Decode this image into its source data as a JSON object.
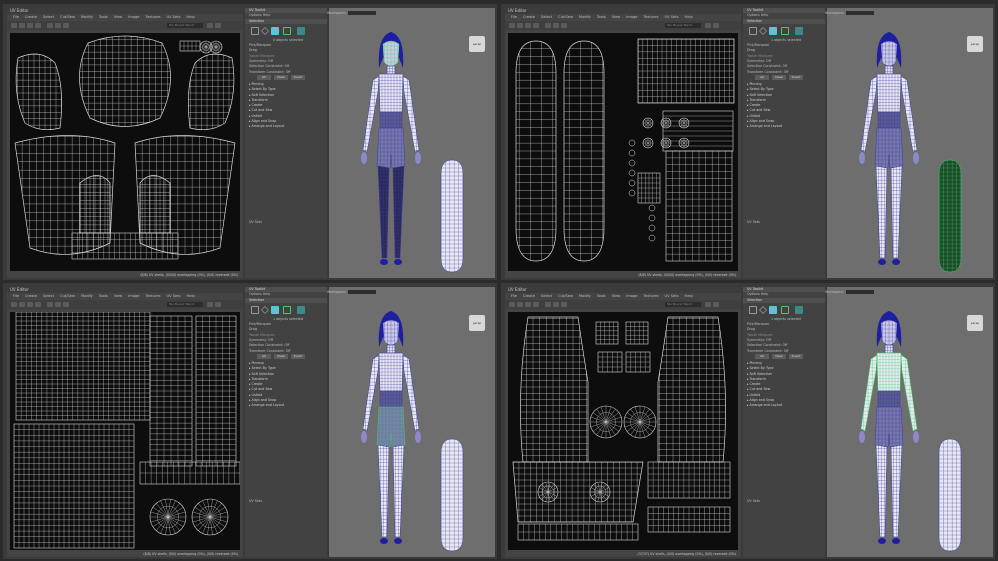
{
  "panels": [
    {
      "uv_title": "UV Editor",
      "menu": [
        "File",
        "Create",
        "Select",
        "Cut/Sew",
        "Modify",
        "Tools",
        "View",
        "Image",
        "Textures",
        "UV Sets",
        "Help"
      ],
      "search_placeholder": "Tex Bound Texcd",
      "status": "(8/8) UV shells, (0/0/0) overlapping (0%), (0/0) reversed (0%)",
      "uv_sets": "UV Sets",
      "toolkit_title": "UV Toolkit",
      "toolkit_menu": "Options  Help",
      "workspace_label": "Workspace:",
      "selection_header": "Selection",
      "pick_marquee": "Pick/Marquee",
      "drag": "Drag",
      "tweak": "Tweak Marquee",
      "selected_text": "0 objects selected",
      "symmetry": "Symmetry:  Off",
      "selection_constraint": "Selection Constraint:  Off",
      "transform_constraint": "Transform Constraint:  Off",
      "btn_all": "All",
      "btn_clear": "Clear",
      "btn_invert": "Invert",
      "sections": [
        "Pinning",
        "Select By Type",
        "Soft Selection",
        "Transform",
        "Create",
        "Cut and Sew",
        "Unfold",
        "Align and Snap",
        "Arrange and Layout"
      ],
      "persp": "persp",
      "highlight": "head"
    },
    {
      "uv_title": "UV Editor",
      "menu": [
        "File",
        "Create",
        "Select",
        "Cut/Sew",
        "Modify",
        "Tools",
        "View",
        "Image",
        "Textures",
        "UV Sets",
        "Help"
      ],
      "search_placeholder": "Tex Bound Texcd",
      "status": "(8/8) UV shells, (0/0/0) overlapping (0%), (0/0) reversed (0%)",
      "uv_sets": "UV Sets",
      "toolkit_title": "UV Toolkit",
      "toolkit_menu": "Options  Help",
      "workspace_label": "Workspace:",
      "selection_header": "Selection",
      "pick_marquee": "Pick/Marquee",
      "drag": "Drag",
      "tweak": "Tweak Marquee",
      "selected_text": "1 objects selected",
      "symmetry": "Symmetry:  Off",
      "selection_constraint": "Selection Constraint:  Off",
      "transform_constraint": "Transform Constraint:  Off",
      "btn_all": "All",
      "btn_clear": "Clear",
      "btn_invert": "Invert",
      "sections": [
        "Pinning",
        "Select By Type",
        "Soft Selection",
        "Transform",
        "Create",
        "Cut and Sew",
        "Unfold",
        "Align and Snap",
        "Arrange and Layout"
      ],
      "persp": "persp",
      "highlight": "board"
    },
    {
      "uv_title": "UV Editor",
      "menu": [
        "File",
        "Create",
        "Select",
        "Cut/Sew",
        "Modify",
        "Tools",
        "View",
        "Image",
        "Textures",
        "UV Sets",
        "Help"
      ],
      "search_placeholder": "Tex Bound Texcd",
      "status": "(8/8) UV shells, (0/0) overlapping (0%), (0/0) reversed (0%)",
      "uv_sets": "UV Sets",
      "toolkit_title": "UV Toolkit",
      "toolkit_menu": "Options  Help",
      "workspace_label": "Workspace:",
      "selection_header": "Selection",
      "pick_marquee": "Pick/Marquee",
      "drag": "Drag",
      "tweak": "Tweak Marquee",
      "selected_text": "1 objects selected",
      "symmetry": "Symmetry:  Off",
      "selection_constraint": "Selection Constraint:  Off",
      "transform_constraint": "Transform Constraint:  Off",
      "btn_all": "All",
      "btn_clear": "Clear",
      "btn_invert": "Invert",
      "sections": [
        "Pinning",
        "Select By Type",
        "Soft Selection",
        "Transform",
        "Create",
        "Cut and Sew",
        "Unfold",
        "Align and Snap",
        "Arrange and Layout"
      ],
      "persp": "persp",
      "highlight": "shorts"
    },
    {
      "uv_title": "UV Editor",
      "menu": [
        "File",
        "Create",
        "Select",
        "Cut/Sew",
        "Modify",
        "Tools",
        "View",
        "Image",
        "Textures",
        "UV Sets",
        "Help"
      ],
      "search_placeholder": "Tex Bound Texcd",
      "status": "(37/37) UV shells, (0/0) overlapping (0%), (0/0) reversed (0%)",
      "uv_sets": "UV Sets",
      "toolkit_title": "UV Toolkit",
      "toolkit_menu": "Options  Help",
      "workspace_label": "Workspace:",
      "selection_header": "Selection",
      "pick_marquee": "Pick/Marquee",
      "drag": "Drag",
      "tweak": "Tweak Marquee",
      "selected_text": "1 objects selected",
      "symmetry": "Symmetry:  Off",
      "selection_constraint": "Selection Constraint:  Off",
      "transform_constraint": "Transform Constraint:  Off",
      "btn_all": "All",
      "btn_clear": "Clear",
      "btn_invert": "Invert",
      "sections": [
        "Pinning",
        "Select By Type",
        "Soft Selection",
        "Transform",
        "Create",
        "Cut and Sew",
        "Unfold",
        "Align and Snap",
        "Arrange and Layout"
      ],
      "persp": "persp",
      "highlight": "top"
    }
  ],
  "colors": {
    "uv_wire": "#d9d9d9",
    "selection_green": "#3ecf6a",
    "hair_blue": "#1e1ea0",
    "mesh_blue": "#3a3aa6",
    "body_white": "#e8e8f2"
  }
}
